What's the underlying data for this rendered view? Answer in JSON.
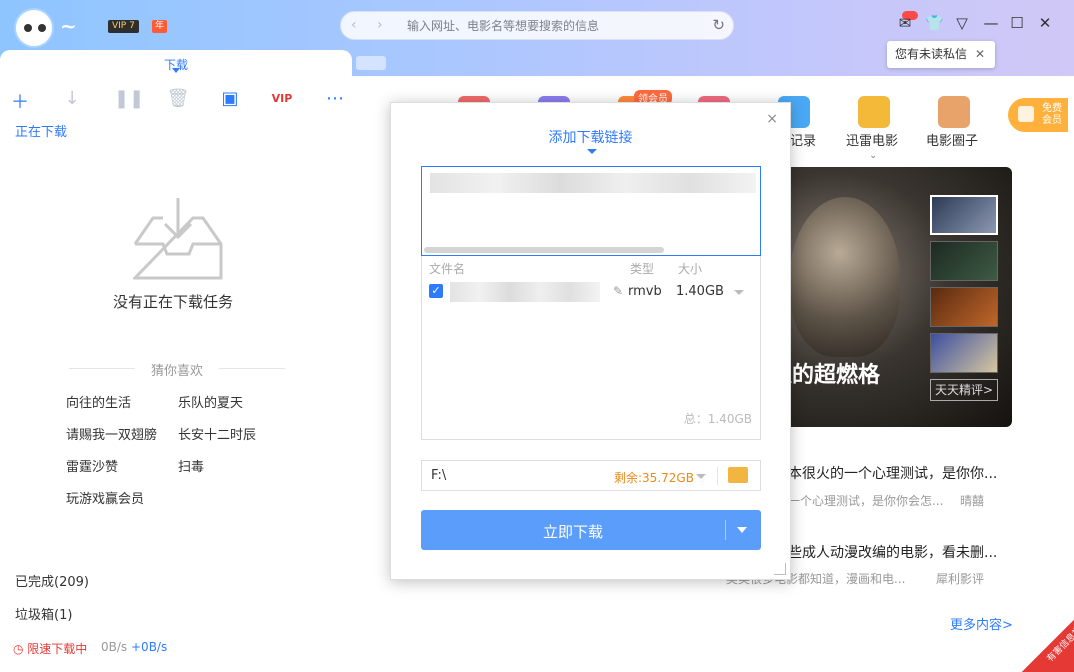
{
  "titlebar": {
    "vip_badge": "VIP 7",
    "year_badge": "年",
    "address_placeholder": "输入网址、电影名等想要搜索的信息",
    "tooltip": "您有未读私信",
    "tooltip_close": "✕"
  },
  "tab": {
    "label": "下载"
  },
  "left": {
    "section": "正在下载",
    "empty_text": "没有正在下载任务",
    "guess_title": "猜你喜欢",
    "suggestions": [
      "向往的生活",
      "乐队的夏天",
      "请赐我一双翅膀",
      "长安十二时辰",
      "雷霆沙赞",
      "扫毒",
      "玩游戏赢会员"
    ],
    "completed": "已完成(209)",
    "trash": "垃圾箱(1)",
    "status": "限速下载中",
    "speed_down": "0B/s",
    "speed_up": "+0B/s"
  },
  "right": {
    "member_tag": "领会员",
    "apps": [
      "记录",
      "迅雷电影",
      "电影圈子"
    ],
    "free_member": "免费\n会员",
    "banner_title": "人的超燃格",
    "banner_more": "天天精评>",
    "news": [
      {
        "title": "本很火的一个心理测试，是你你...",
        "sub": "一个心理测试，是你你会怎...",
        "author": "晴囍"
      },
      {
        "title": "些成人动漫改编的电影，看未删...",
        "sub": "奥美很多电影都知道，漫画和电...",
        "author": "犀利影评"
      }
    ],
    "more_content": "更多内容>",
    "report": "有害信息举报"
  },
  "dialog": {
    "title": "添加下载链接",
    "close": "×",
    "col_name": "文件名",
    "col_type": "类型",
    "col_size": "大小",
    "file_type": "rmvb",
    "file_size": "1.40GB",
    "total": "总：1.40GB",
    "path": "F:\\",
    "free_space": "剩余:35.72GB",
    "download_button": "立即下载"
  },
  "colors": {
    "accent": "#2f7bff",
    "button": "#5b9dfb",
    "warning": "#e88a1a",
    "danger": "#e53935"
  }
}
